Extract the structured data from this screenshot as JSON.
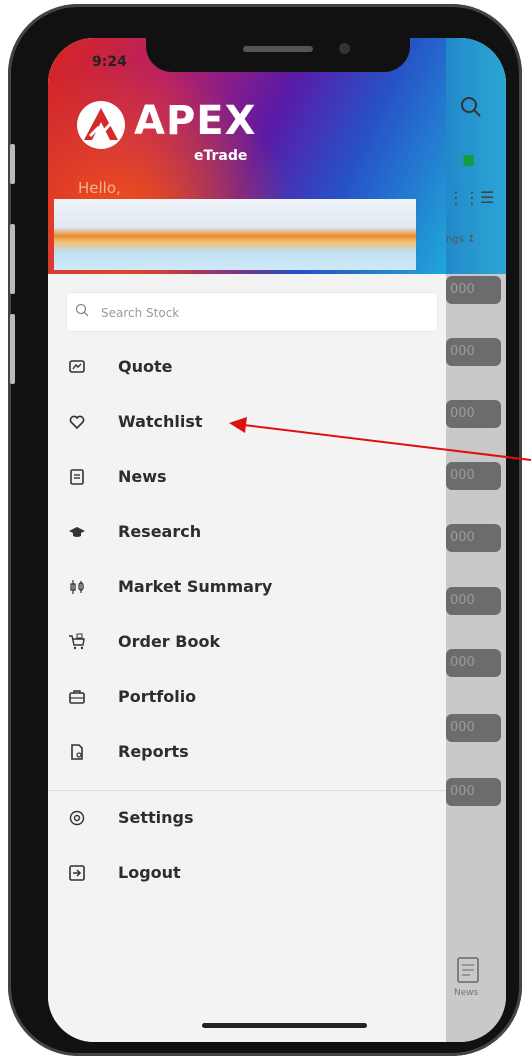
{
  "status_bar": {
    "time": "9:24"
  },
  "brand": {
    "name": "APEX",
    "sub": "eTrade"
  },
  "greeting": "Hello,",
  "search": {
    "placeholder": "Search Stock"
  },
  "menu": [
    {
      "label": "Quote",
      "icon": "chart-screen-icon"
    },
    {
      "label": "Watchlist",
      "icon": "heart-icon"
    },
    {
      "label": "News",
      "icon": "news-icon"
    },
    {
      "label": "Research",
      "icon": "graduation-cap-icon"
    },
    {
      "label": "Market Summary",
      "icon": "candlestick-icon"
    },
    {
      "label": "Order Book",
      "icon": "cart-icon"
    },
    {
      "label": "Portfolio",
      "icon": "briefcase-icon"
    },
    {
      "label": "Reports",
      "icon": "report-file-icon"
    },
    {
      "label": "Settings",
      "icon": "gear-icon"
    },
    {
      "label": "Logout",
      "icon": "logout-icon"
    }
  ],
  "background": {
    "sort_label": "ngs ↕",
    "row_value": "000",
    "bottom_tab_label": "News"
  },
  "colors": {
    "annotation_arrow": "#e01010",
    "drawer_bg": "#f3f3f3",
    "menu_text": "#2d2d2d"
  }
}
